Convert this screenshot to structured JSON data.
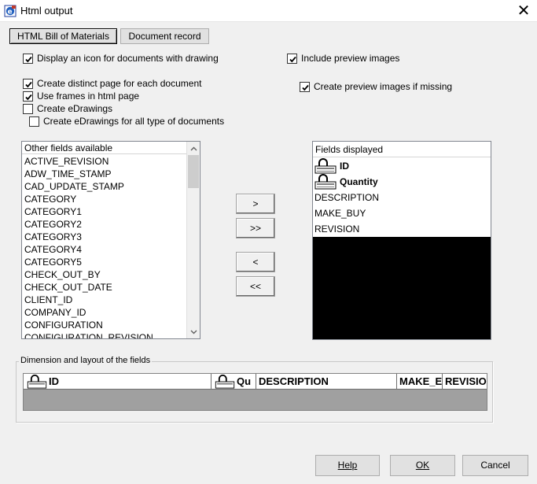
{
  "window": {
    "title": "Html output",
    "close_glyph": "✕"
  },
  "tabs": [
    {
      "label": "HTML Bill of Materials",
      "active": true
    },
    {
      "label": "Document record",
      "active": false
    }
  ],
  "options": {
    "display_icon": {
      "label": "Display an icon for documents with drawing",
      "checked": true
    },
    "distinct_page": {
      "label": "Create distinct page for each document",
      "checked": true
    },
    "use_frames": {
      "label": "Use frames in html page",
      "checked": true
    },
    "create_edrawings": {
      "label": "Create eDrawings",
      "checked": false
    },
    "edrawings_all": {
      "label": "Create eDrawings for all type of documents",
      "checked": false
    },
    "include_preview": {
      "label": "Include preview images",
      "checked": true
    },
    "create_preview": {
      "label": "Create preview images if missing",
      "checked": true
    }
  },
  "available_list": {
    "header": "Other fields available",
    "items": [
      "ACTIVE_REVISION",
      "ADW_TIME_STAMP",
      "CAD_UPDATE_STAMP",
      "CATEGORY",
      "CATEGORY1",
      "CATEGORY2",
      "CATEGORY3",
      "CATEGORY4",
      "CATEGORY5",
      "CHECK_OUT_BY",
      "CHECK_OUT_DATE",
      "CLIENT_ID",
      "COMPANY_ID",
      "CONFIGURATION",
      "CONFIGURATION_REVISION"
    ]
  },
  "transfer_buttons": {
    "add": ">",
    "add_all": ">>",
    "remove": "<",
    "remove_all": "<<"
  },
  "displayed_list": {
    "header": "Fields displayed",
    "items": [
      {
        "label": "ID",
        "locked": true
      },
      {
        "label": "Quantity",
        "locked": true
      },
      {
        "label": "DESCRIPTION",
        "locked": false
      },
      {
        "label": "MAKE_BUY",
        "locked": false
      },
      {
        "label": "REVISION",
        "locked": false
      }
    ]
  },
  "layout_group": {
    "legend": "Dimension and layout of the fields",
    "columns": [
      {
        "label": "ID",
        "locked": true
      },
      {
        "label": "Qu",
        "locked": true
      },
      {
        "label": "DESCRIPTION",
        "locked": false
      },
      {
        "label": "MAKE_E",
        "locked": false
      },
      {
        "label": "REVISIO",
        "locked": false
      }
    ]
  },
  "footer": {
    "help_label": "Help",
    "ok_label": "OK",
    "cancel_label": "Cancel"
  },
  "icons": [
    "app-icon",
    "close-icon",
    "checkmark-icon",
    "lock-icon",
    "scroll-up-icon",
    "scroll-down-icon"
  ]
}
